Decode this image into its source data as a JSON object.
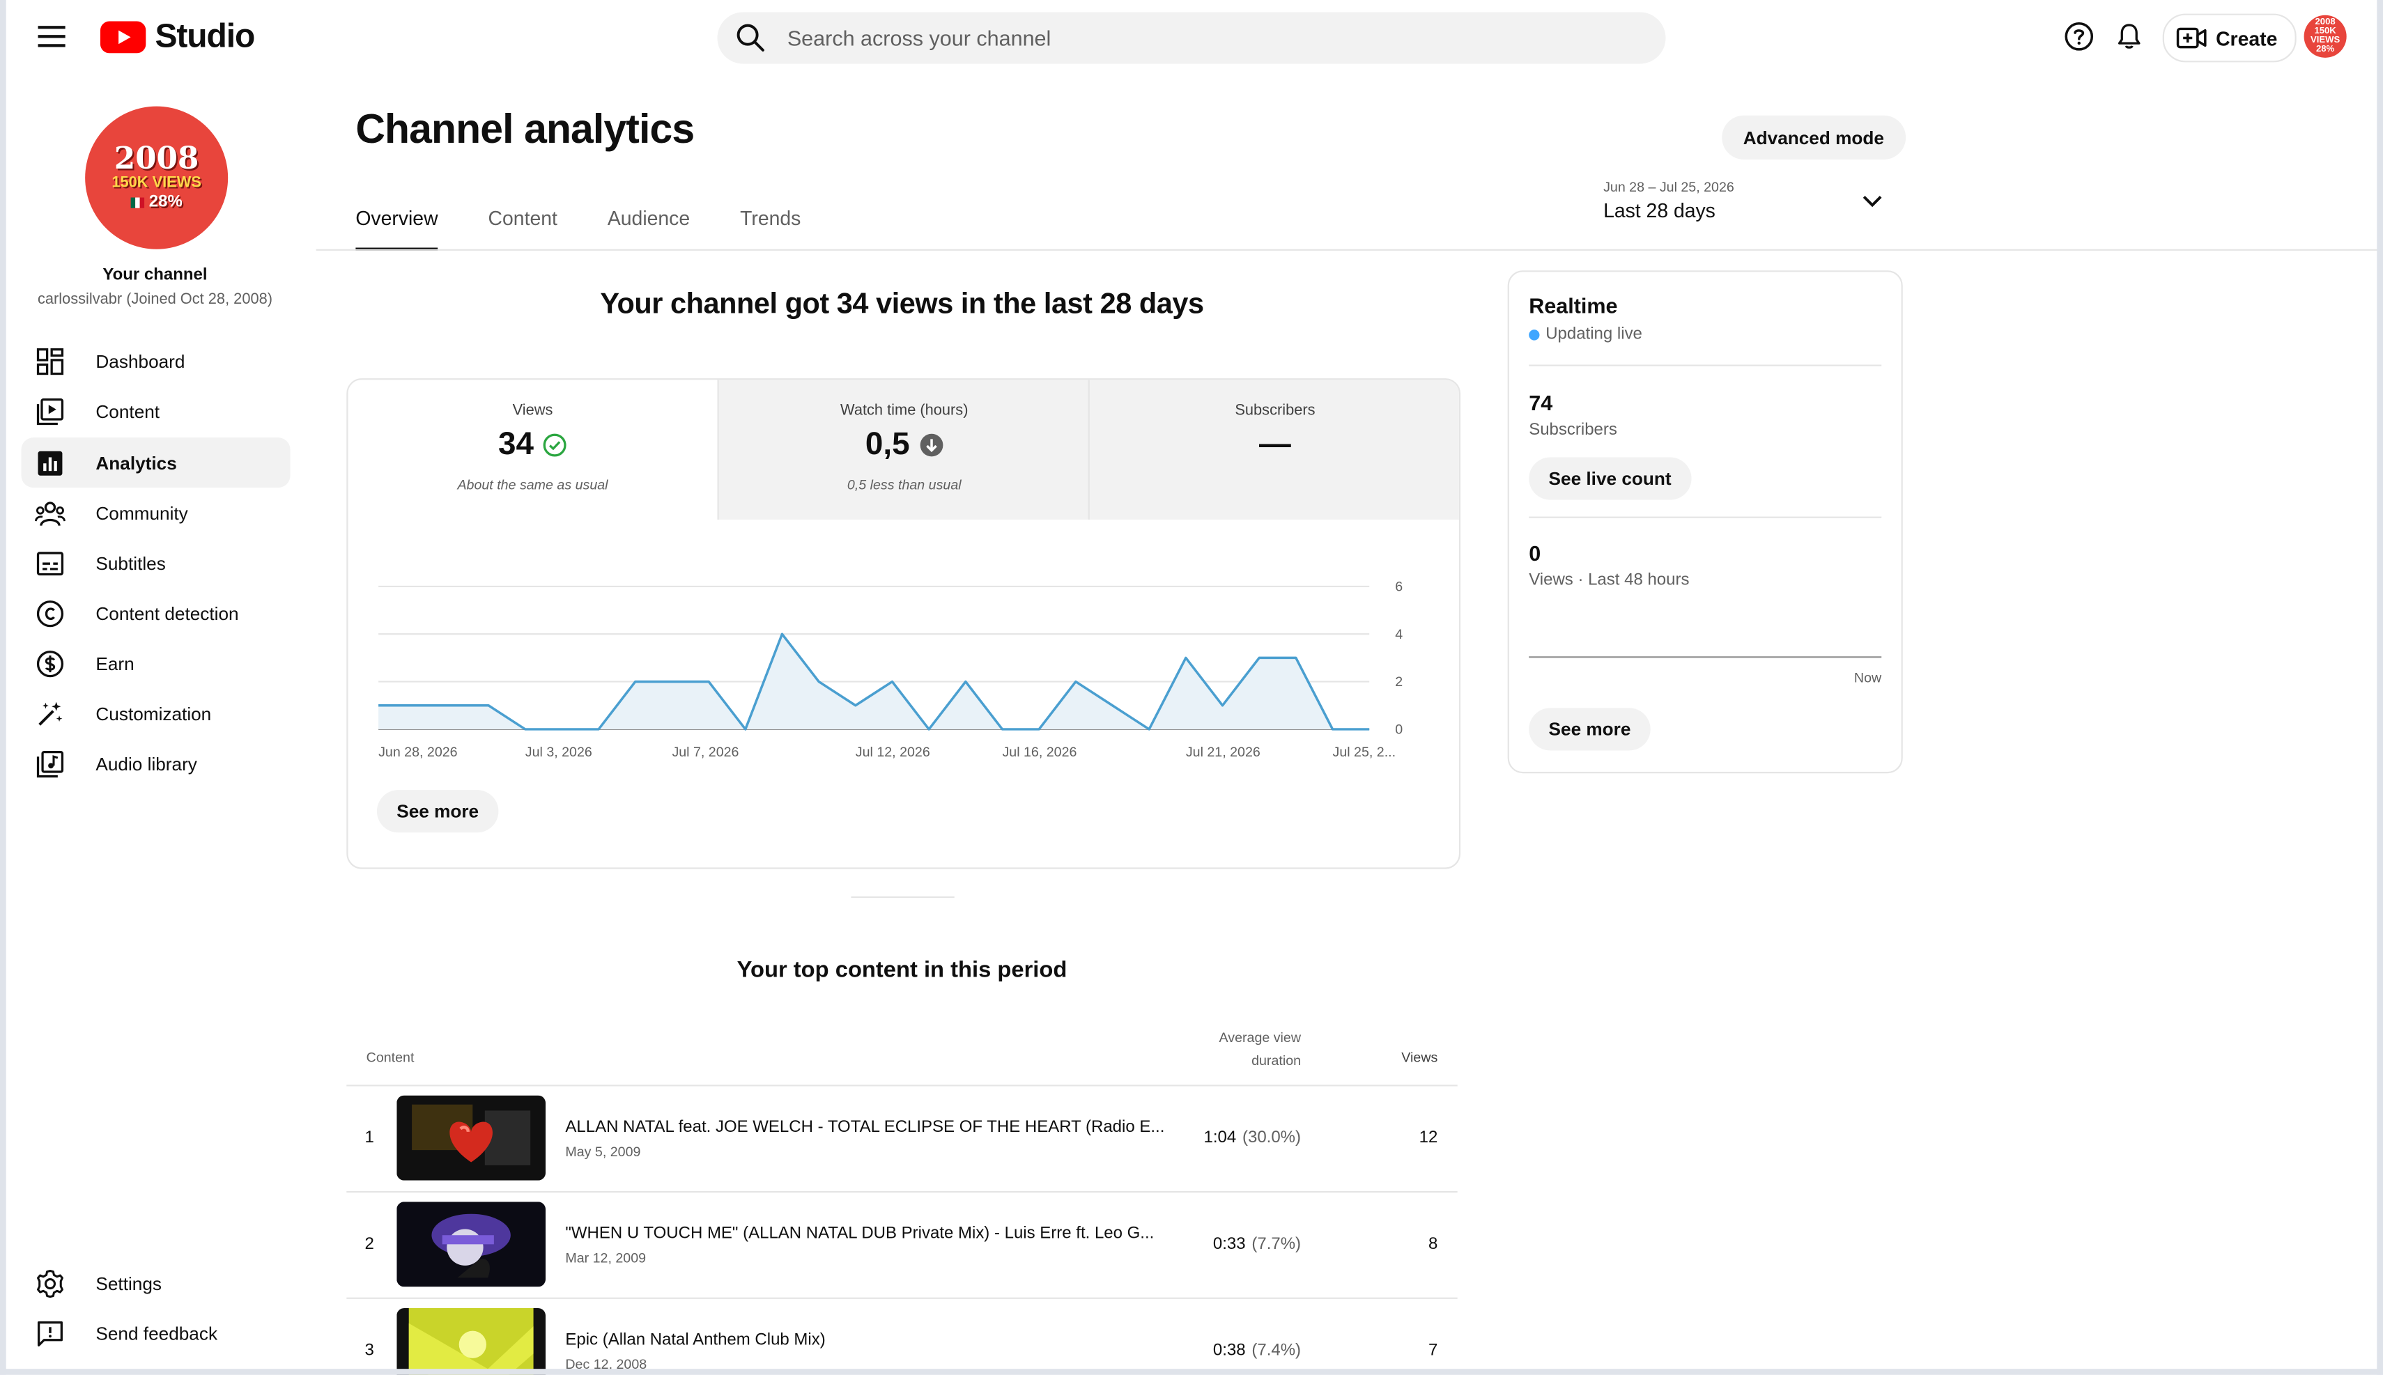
{
  "app": {
    "logo_text": "Studio"
  },
  "header": {
    "search_placeholder": "Search across your channel",
    "create_label": "Create",
    "avatar_text": "2008 150K VIEWS 28%"
  },
  "channel": {
    "avatar_year": "2008",
    "avatar_views": "150K VIEWS",
    "avatar_percent": "28%",
    "title": "Your channel",
    "subtitle": "carlossilvabr (Joined Oct 28, 2008)"
  },
  "sidebar": {
    "items": [
      {
        "label": "Dashboard",
        "icon": "dashboard-icon"
      },
      {
        "label": "Content",
        "icon": "content-icon"
      },
      {
        "label": "Analytics",
        "icon": "analytics-icon",
        "active": true
      },
      {
        "label": "Community",
        "icon": "community-icon"
      },
      {
        "label": "Subtitles",
        "icon": "subtitles-icon"
      },
      {
        "label": "Content detection",
        "icon": "copyright-icon"
      },
      {
        "label": "Earn",
        "icon": "dollar-icon"
      },
      {
        "label": "Customization",
        "icon": "magic-wand-icon"
      },
      {
        "label": "Audio library",
        "icon": "audio-library-icon"
      }
    ],
    "bottom": [
      {
        "label": "Settings",
        "icon": "gear-icon"
      },
      {
        "label": "Send feedback",
        "icon": "feedback-icon"
      }
    ]
  },
  "main": {
    "title": "Channel analytics",
    "advanced_mode": "Advanced mode",
    "tabs": [
      {
        "label": "Overview",
        "active": true
      },
      {
        "label": "Content"
      },
      {
        "label": "Audience"
      },
      {
        "label": "Trends"
      }
    ],
    "date_range": {
      "dates": "Jun 28 – Jul 25, 2026",
      "label": "Last 28 days"
    },
    "headline": "Your channel got 34 views in the last 28 days",
    "metrics": [
      {
        "title": "Views",
        "value": "34",
        "status_icon": "check-circle-icon",
        "comparison": "About the same as usual"
      },
      {
        "title": "Watch time (hours)",
        "value": "0,5",
        "status_icon": "arrow-down-circle-icon",
        "comparison": "0,5 less than usual"
      },
      {
        "title": "Subscribers",
        "value": "—",
        "comparison": ""
      }
    ],
    "see_more": "See more",
    "top_content": {
      "title": "Your top content in this period",
      "col_content": "Content",
      "col_avd": "Average view duration",
      "col_views": "Views",
      "rows": [
        {
          "rank": "1",
          "title": "ALLAN NATAL feat. JOE WELCH - TOTAL ECLIPSE OF THE HEART (Radio E...",
          "date": "May 5, 2009",
          "avd": "1:04",
          "avd_pct": "(30.0%)",
          "views": "12"
        },
        {
          "rank": "2",
          "title": "\"WHEN U TOUCH ME\" (ALLAN NATAL DUB Private Mix) - Luis Erre ft. Leo G...",
          "date": "Mar 12, 2009",
          "avd": "0:33",
          "avd_pct": "(7.7%)",
          "views": "8"
        },
        {
          "rank": "3",
          "title": "Epic (Allan Natal Anthem Club Mix)",
          "date": "Dec 12, 2008",
          "avd": "0:38",
          "avd_pct": "(7.4%)",
          "views": "7"
        }
      ]
    }
  },
  "realtime": {
    "title": "Realtime",
    "status": "Updating live",
    "subscribers_value": "74",
    "subscribers_label": "Subscribers",
    "live_count_button": "See live count",
    "views_value": "0",
    "views_label": "Views · Last 48 hours",
    "now_label": "Now",
    "see_more": "See more"
  },
  "colors": {
    "accent": "#3ea6ff",
    "line": "#4a9fd0",
    "area": "#e9f2f8",
    "brand_red": "#ff0000",
    "avatar_red": "#e8453c"
  },
  "chart_data": {
    "type": "area",
    "series": [
      {
        "values": [
          1,
          1,
          1,
          1,
          0,
          0,
          0,
          2,
          2,
          2,
          0,
          4,
          2,
          1,
          2,
          0,
          2,
          0,
          0,
          2,
          1,
          0,
          3,
          1,
          3,
          3,
          0,
          0
        ]
      }
    ],
    "x": [
      "Jun 28, 2026",
      "Jun 29",
      "Jun 30",
      "Jul 1",
      "Jul 2",
      "Jul 3, 2026",
      "Jul 4",
      "Jul 5",
      "Jul 6",
      "Jul 7, 2026",
      "Jul 8",
      "Jul 9",
      "Jul 10",
      "Jul 11",
      "Jul 12, 2026",
      "Jul 13",
      "Jul 14",
      "Jul 15",
      "Jul 16, 2026",
      "Jul 17",
      "Jul 18",
      "Jul 19",
      "Jul 20",
      "Jul 21, 2026",
      "Jul 22",
      "Jul 23",
      "Jul 24",
      "Jul 25, 2026"
    ],
    "x_tick_labels": [
      {
        "index": 0,
        "label": "Jun 28, 2026"
      },
      {
        "index": 4,
        "label": "Jul 3, 2026"
      },
      {
        "index": 8,
        "label": "Jul 7, 2026"
      },
      {
        "index": 13,
        "label": "Jul 12, 2026"
      },
      {
        "index": 17,
        "label": "Jul 16, 2026"
      },
      {
        "index": 22,
        "label": "Jul 21, 2026"
      },
      {
        "index": 26,
        "label": "Jul 25, 2..."
      }
    ],
    "y_ticks": [
      "0",
      "2",
      "4",
      "6"
    ],
    "ylim": [
      0,
      6
    ],
    "grid": true,
    "y_axis_side": "right"
  }
}
